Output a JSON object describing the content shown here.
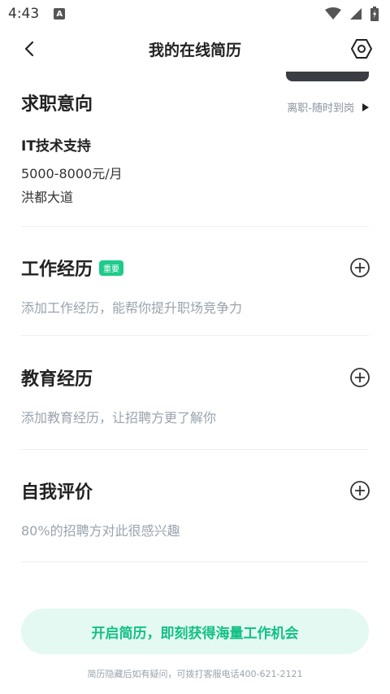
{
  "status_bar": {
    "time": "4:43",
    "notif_letter": "A"
  },
  "header": {
    "title": "我的在线简历"
  },
  "intent": {
    "title": "求职意向",
    "status": "离职-随时到岗",
    "job_title": "IT技术支持",
    "salary": "5000-8000元/月",
    "location": "洪都大道"
  },
  "work": {
    "title": "工作经历",
    "badge": "重要",
    "desc": "添加工作经历，能帮你提升职场竞争力"
  },
  "education": {
    "title": "教育经历",
    "desc": "添加教育经历，让招聘方更了解你"
  },
  "self_eval": {
    "title": "自我评价",
    "desc": "80%的招聘方对此很感兴趣"
  },
  "cta": {
    "label": "开启简历，即刻获得海量工作机会"
  },
  "footer": {
    "note": "简历隐藏后如有疑问，可拨打客服电话400-621-2121"
  },
  "colors": {
    "accent": "#12c085",
    "badge": "#1ecb8a",
    "cta_bg": "#e4f9f1"
  }
}
